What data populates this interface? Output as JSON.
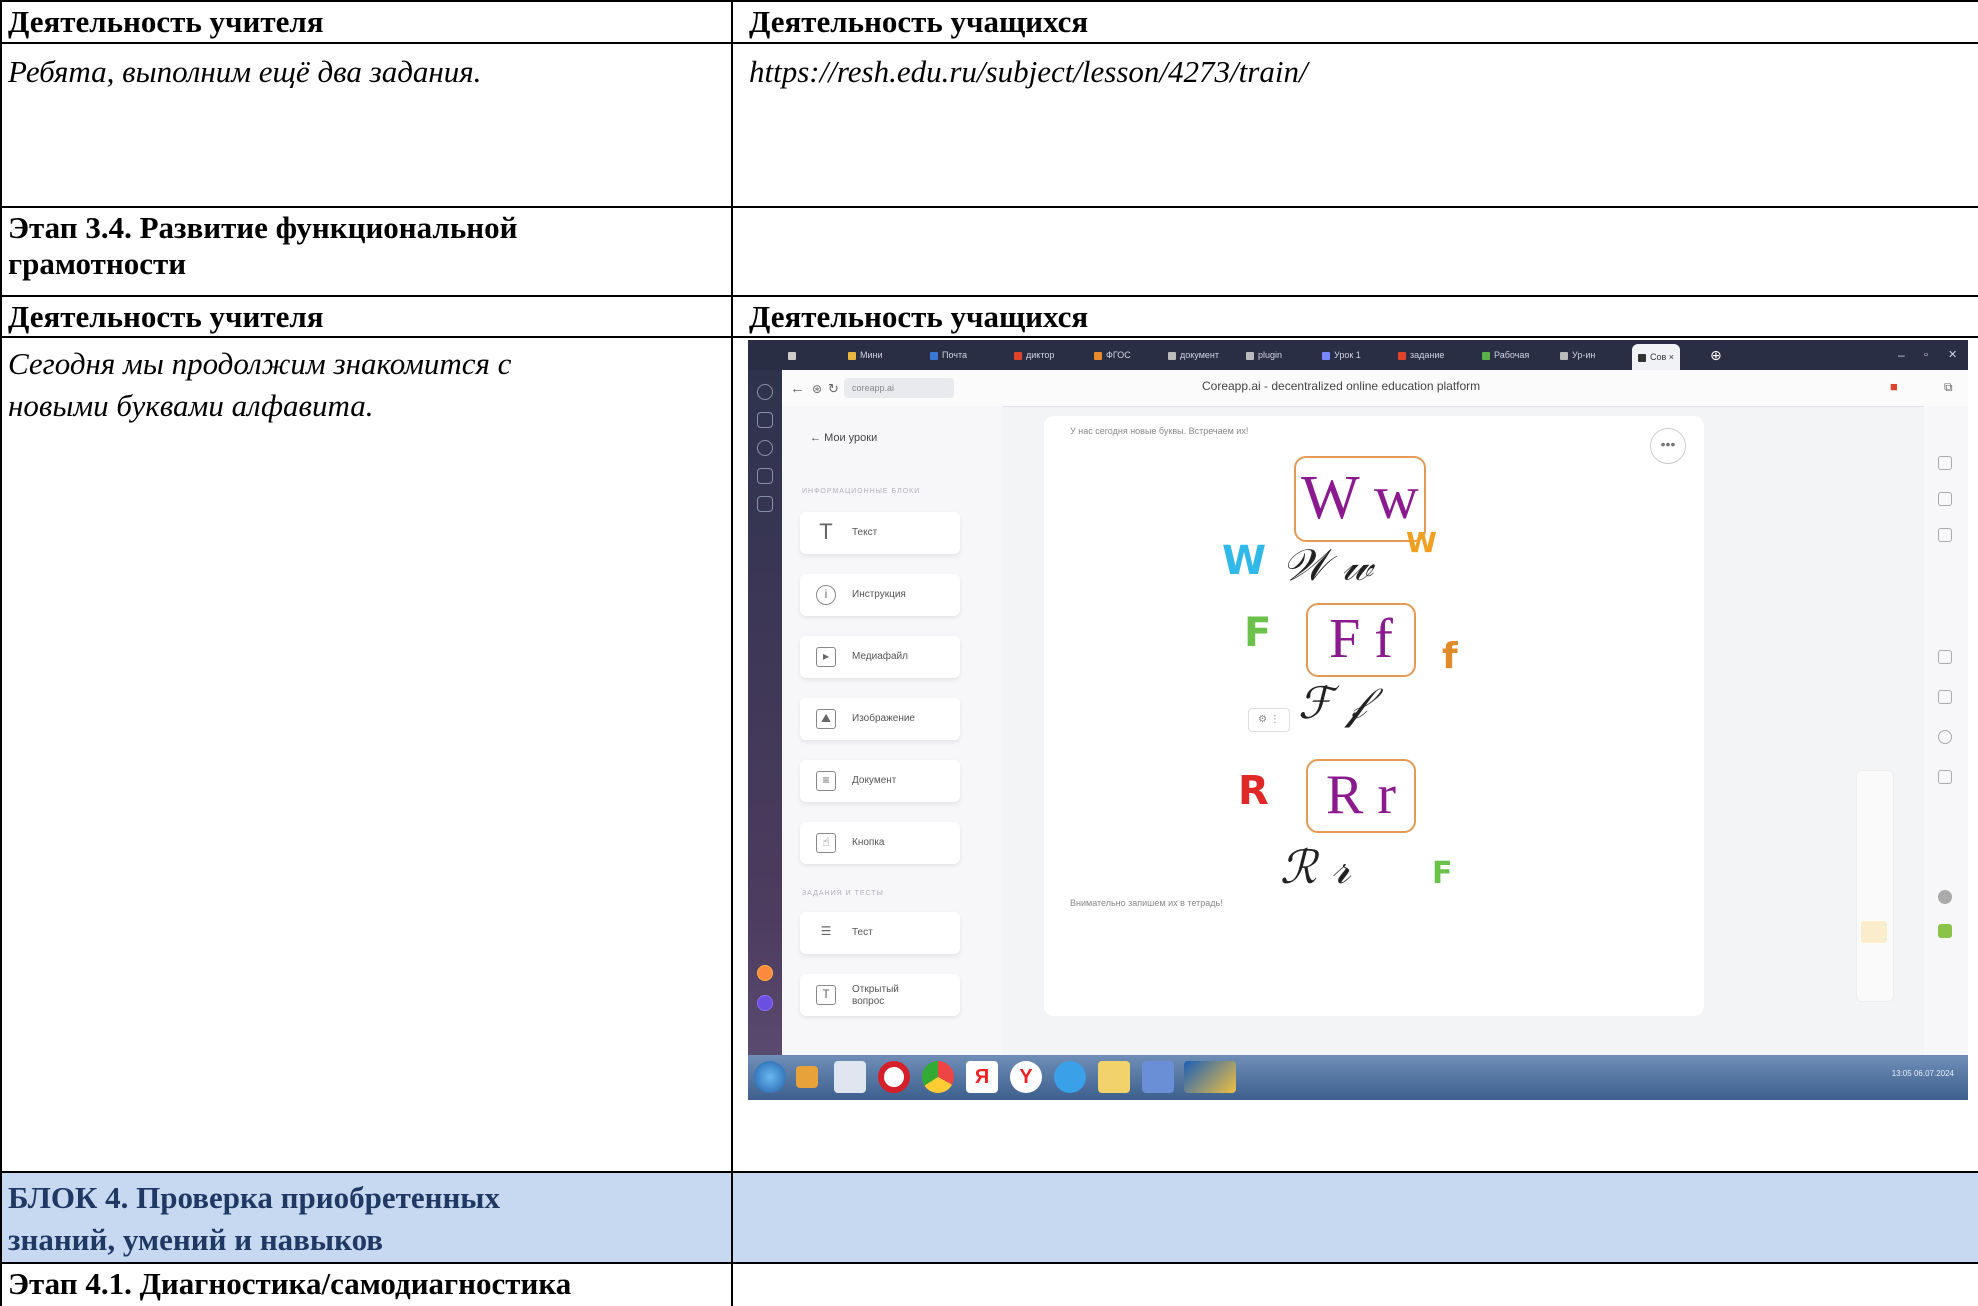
{
  "table": {
    "row1": {
      "left": "Деятельность учителя",
      "right": "Деятельность учащихся"
    },
    "row2": {
      "left": "Ребята, выполним ещё два задания.",
      "right": "https://resh.edu.ru/subject/lesson/4273/train/"
    },
    "row3": {
      "left_line1": "Этап 3.4. Развитие функциональной",
      "left_line2": "грамотности"
    },
    "row4": {
      "left": "Деятельность учителя",
      "right": "Деятельность учащихся"
    },
    "row5": {
      "left_line1": "Сегодня мы продолжим знакомится с",
      "left_line2": "новыми буквами алфавита."
    },
    "row6": {
      "left_line1": "БЛОК 4. Проверка приобретенных",
      "left_line2": "знаний, умений и навыков"
    },
    "row7": {
      "left": "Этап 4.1. Диагностика/самодиагностика"
    }
  },
  "screenshot": {
    "tabs": [
      "Мини",
      "Почта",
      "диктор",
      "ФГОС",
      "документ",
      "plugin",
      "Урок 1",
      "задание",
      "Рабочая",
      "Ур-ин",
      "Сов"
    ],
    "url": "coreapp.ai",
    "page_title": "Coreapp.ai - decentralized online education platform",
    "back_link": "Мои уроки",
    "section_info": "ИНФОРМАЦИОННЫЕ БЛОКИ",
    "blocks": [
      "Текст",
      "Инструкция",
      "Медиафайл",
      "Изображение",
      "Документ",
      "Кнопка"
    ],
    "section_tasks": "ЗАДАНИЯ И ТЕСТЫ",
    "task_blocks": [
      "Тест",
      "Открытый вопрос"
    ],
    "intro_text": "У нас сегодня новые буквы. Встречаем их!",
    "footer_text": "Внимательно запишем их в тетрадь!",
    "letters": [
      "W w",
      "F f",
      "R r"
    ],
    "script_letters": [
      "𝒲 𝓌",
      "ℱ 𝒻",
      "ℛ 𝓇"
    ],
    "sticker_letters": [
      "W",
      "W",
      "F",
      "f",
      "R",
      "F"
    ],
    "tray_time": "13:05",
    "tray_date": "06.07.2024"
  }
}
